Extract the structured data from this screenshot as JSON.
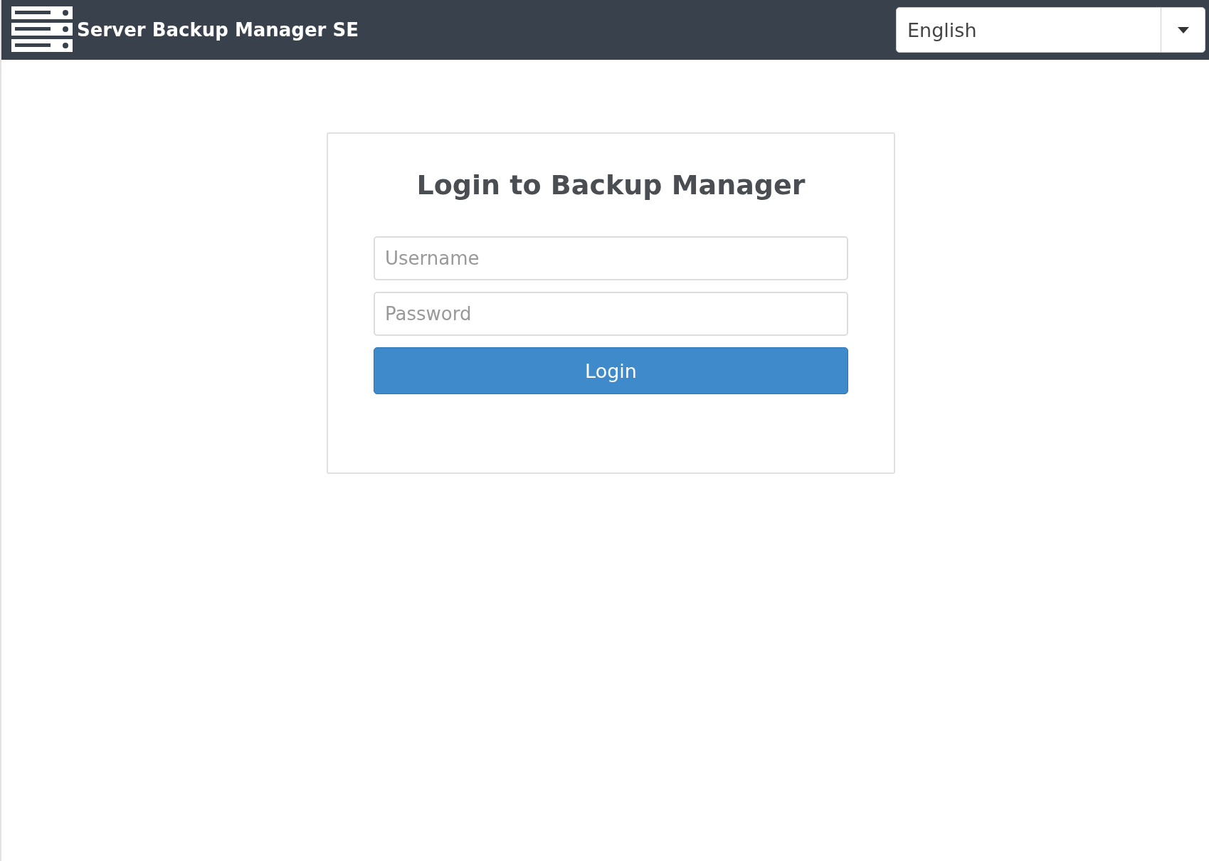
{
  "header": {
    "title": "Server Backup Manager SE",
    "language_select": {
      "value": "English"
    }
  },
  "login": {
    "title": "Login to Backup Manager",
    "fields": [
      {
        "placeholder": "Username"
      },
      {
        "placeholder": "Password"
      }
    ],
    "button": "Login"
  }
}
